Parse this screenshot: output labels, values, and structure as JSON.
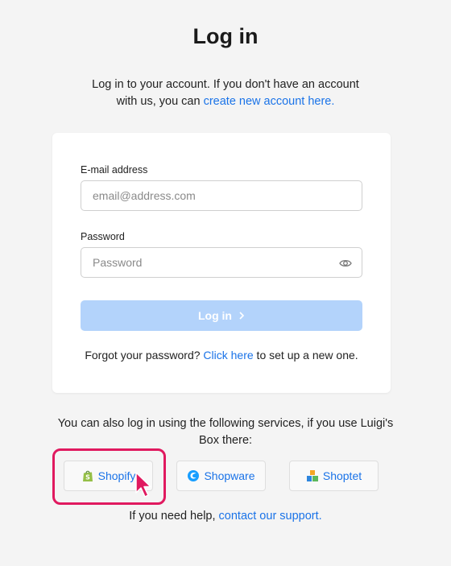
{
  "page": {
    "title": "Log in",
    "intro_text": "Log in to your account. If you don't have an account with us, you can ",
    "intro_link": "create new account here."
  },
  "form": {
    "email_label": "E-mail address",
    "email_placeholder": "email@address.com",
    "email_value": "",
    "password_label": "Password",
    "password_placeholder": "Password",
    "password_value": "",
    "login_button": "Log in",
    "login_button_icon": "chevron-right-icon",
    "forgot_prefix": "Forgot your password? ",
    "forgot_link": "Click here",
    "forgot_suffix": " to set up a new one."
  },
  "services": {
    "intro": "You can also log in using the following services, if you use Luigi's Box there:",
    "items": [
      {
        "label": "Shopify",
        "icon": "shopify-bag-icon"
      },
      {
        "label": "Shopware",
        "icon": "shopware-logo-icon"
      },
      {
        "label": "Shoptet",
        "icon": "shoptet-blocks-icon"
      }
    ]
  },
  "help": {
    "prefix": "If you need help, ",
    "link": "contact our support."
  },
  "colors": {
    "link": "#1a73e8",
    "button_disabled": "#b3d3fb",
    "highlight": "#e0195f",
    "background": "#f4f4f4"
  }
}
